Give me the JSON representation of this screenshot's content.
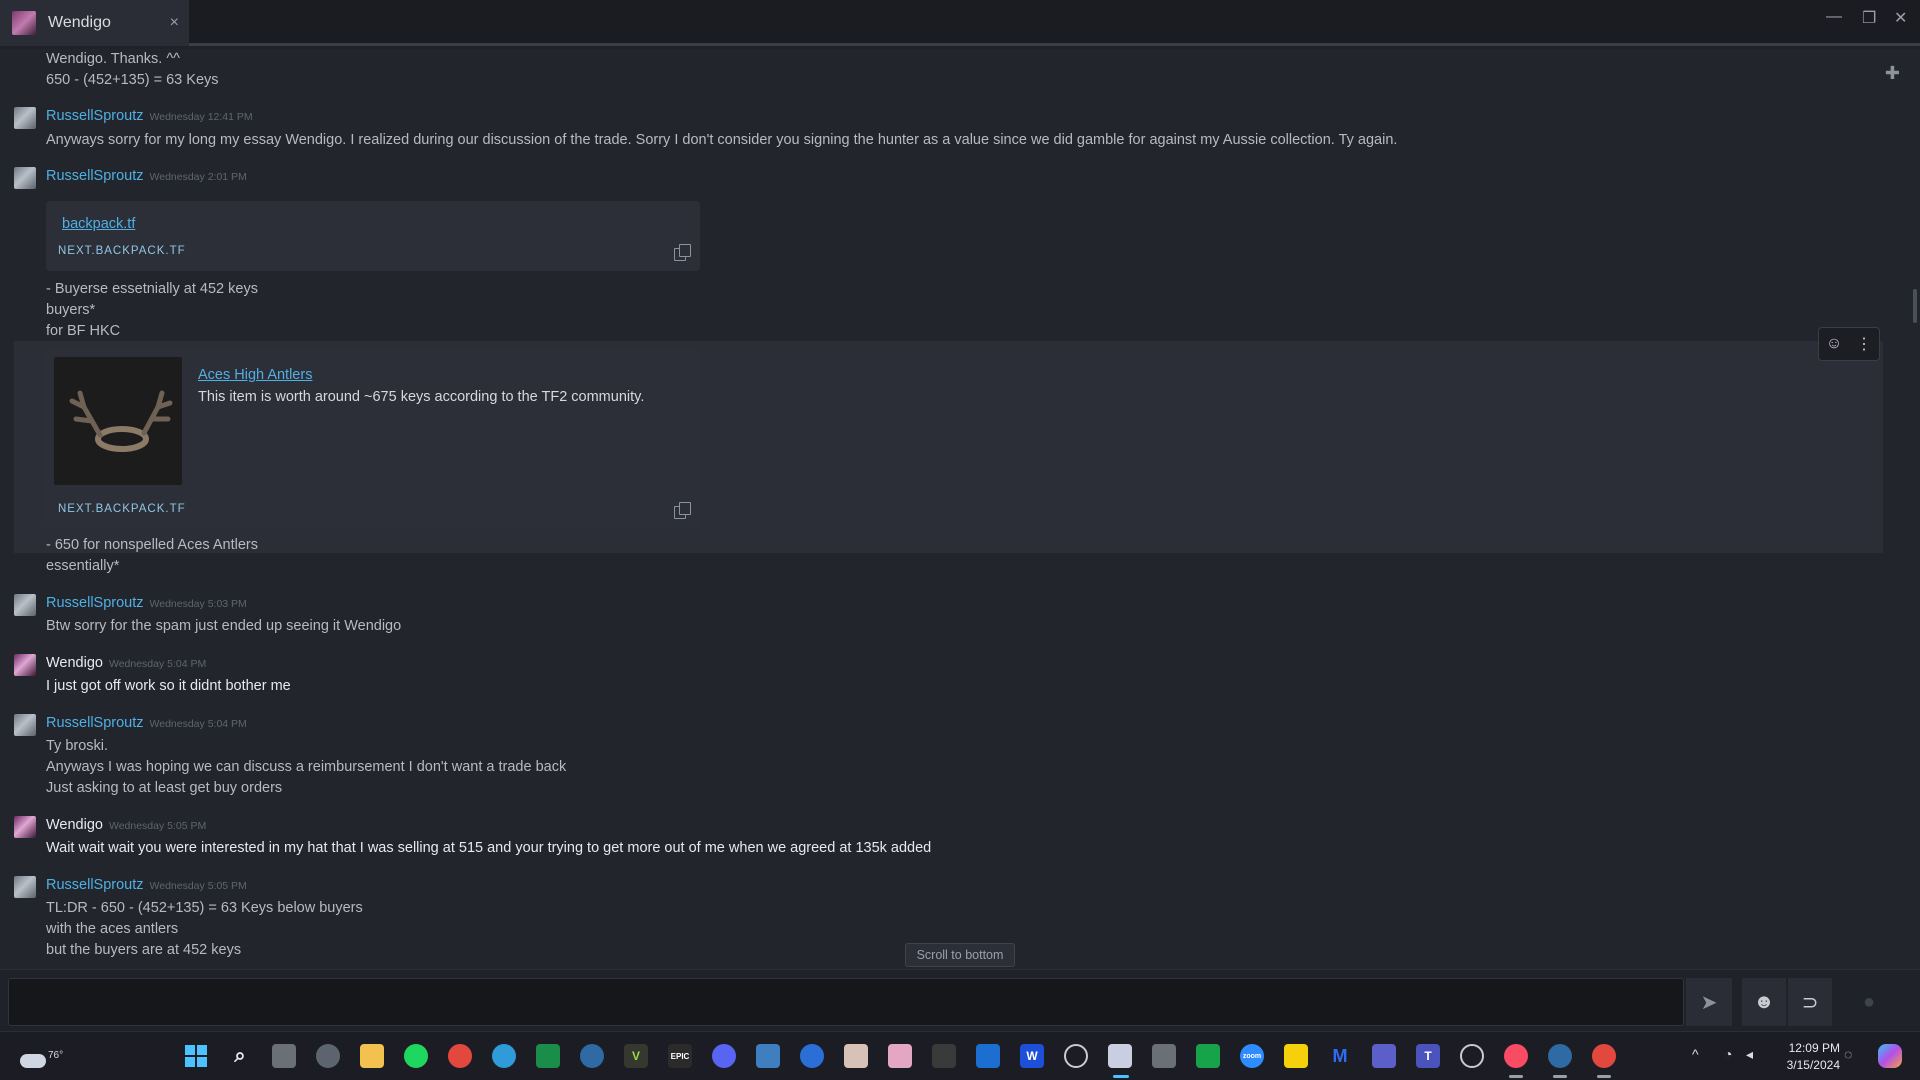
{
  "window": {
    "tab_title": "Wendigo",
    "tab_close": "×",
    "minimize": "—",
    "restore": "❐",
    "close": "✕"
  },
  "top_lines": [
    "Wendigo. Thanks. ^^",
    "650 - (452+135) = 63 Keys"
  ],
  "messages": [
    {
      "author": "RussellSproutz",
      "time": "Wednesday 12:41 PM",
      "lines": [
        "Anyways sorry for my long my essay Wendigo. I realized during our discussion of the trade. Sorry I don't consider you signing the hunter as a value since we did gamble for against my Aussie collection. Ty again."
      ]
    },
    {
      "author": "RussellSproutz",
      "time": "Wednesday 2:01 PM",
      "embed1": {
        "link": "backpack.tf",
        "source": "NEXT.BACKPACK.TF"
      },
      "lines_after_embed1": [
        "- Buyerse essetnially at 452 keys",
        "buyers*",
        "for BF HKC"
      ],
      "embed2": {
        "link": "Aces High Antlers",
        "description": "This item is worth around ~675 keys according to the TF2 community.",
        "source": "NEXT.BACKPACK.TF"
      },
      "lines_after_embed2": [
        "- 650 for nonspelled Aces Antlers",
        "essentially*"
      ]
    },
    {
      "author": "RussellSproutz",
      "time": "Wednesday 5:03 PM",
      "lines": [
        "Btw sorry for the spam just ended up seeing it Wendigo"
      ]
    },
    {
      "author": "Wendigo",
      "time": "Wednesday 5:04 PM",
      "lines": [
        "I just got off work so it didnt bother me"
      ]
    },
    {
      "author": "RussellSproutz",
      "time": "Wednesday 5:04 PM",
      "lines": [
        "Ty broski.",
        "Anyways I was hoping we can discuss a reimbursement I don't want a trade back",
        "Just asking to at least get buy orders"
      ]
    },
    {
      "author": "Wendigo",
      "time": "Wednesday 5:05 PM",
      "lines": [
        "Wait wait wait you were interested in my hat that I was selling at 515 and your trying to get more out of me when we agreed at 135k added"
      ]
    },
    {
      "author": "RussellSproutz",
      "time": "Wednesday 5:05 PM",
      "lines": [
        "TL:DR - 650 - (452+135) = 63 Keys below buyers",
        "with the aces antlers",
        "but the buyers are at 452 keys"
      ]
    }
  ],
  "scroll_to_bottom": "Scroll to bottom",
  "composer": {
    "placeholder": ""
  },
  "taskbar": {
    "weather_temp": "76°",
    "time": "12:09 PM",
    "date": "3/15/2024"
  }
}
